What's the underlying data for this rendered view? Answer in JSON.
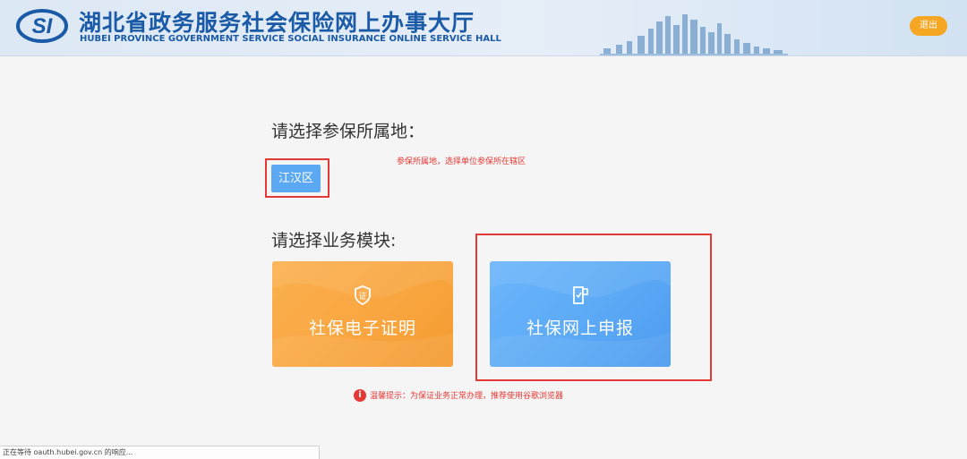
{
  "header": {
    "title_cn": "湖北省政务服务社会保险网上办事大厅",
    "title_en": "HUBEI PROVINCE GOVERNMENT SERVICE SOCIAL INSURANCE ONLINE SERVICE HALL",
    "logo_text": "SI",
    "logout_label": "退出"
  },
  "region": {
    "prompt": "请选择参保所属地：",
    "selected": "江汉区",
    "note": "参保所属地，选择单位参保所在辖区"
  },
  "modules": {
    "prompt": "请选择业务模块:",
    "items": [
      {
        "label": "社保电子证明",
        "icon": "certificate-icon",
        "color": "#f9a53f"
      },
      {
        "label": "社保网上申报",
        "icon": "declare-form-icon",
        "color": "#5aa8f5"
      }
    ]
  },
  "tip": {
    "icon": "info-icon",
    "text": "温馨提示：为保证业务正常办理，推荐使用谷歌浏览器"
  },
  "status": {
    "text": "正在等待 oauth.hubei.gov.cn 的响应..."
  },
  "colors": {
    "brand_blue": "#1a5aa6",
    "accent_orange": "#f5a623",
    "highlight_red": "#e53935",
    "button_blue": "#5aa9f2"
  }
}
